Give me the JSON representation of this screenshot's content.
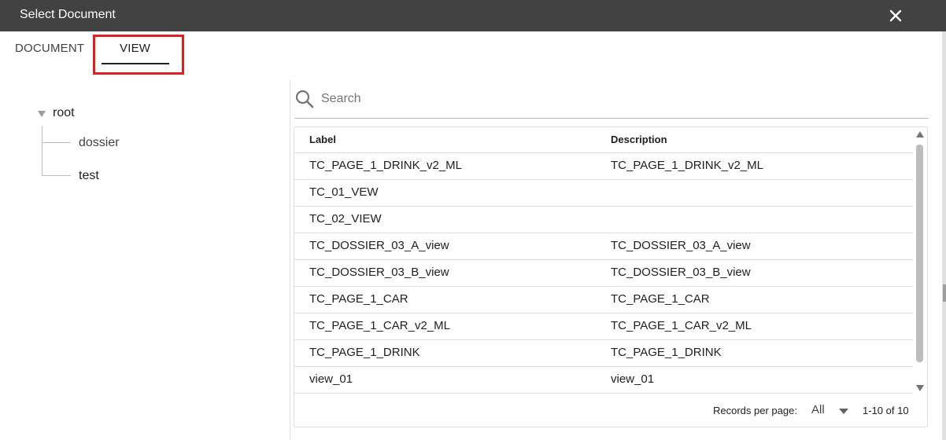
{
  "dialog": {
    "title": "Select Document",
    "close_icon": "close-icon"
  },
  "tabs": [
    {
      "label": "DOCUMENT",
      "active": false
    },
    {
      "label": "VIEW",
      "active": true
    }
  ],
  "tree": {
    "root": "root",
    "children": [
      "dossier",
      "test"
    ]
  },
  "search": {
    "placeholder": "Search",
    "value": "",
    "icon": "search-icon"
  },
  "table": {
    "columns": [
      "Label",
      "Description"
    ],
    "rows": [
      {
        "label": "TC_PAGE_1_DRINK_v2_ML",
        "description": "TC_PAGE_1_DRINK_v2_ML"
      },
      {
        "label": "TC_01_VEW",
        "description": ""
      },
      {
        "label": "TC_02_VIEW",
        "description": ""
      },
      {
        "label": "TC_DOSSIER_03_A_view",
        "description": "TC_DOSSIER_03_A_view"
      },
      {
        "label": "TC_DOSSIER_03_B_view",
        "description": "TC_DOSSIER_03_B_view"
      },
      {
        "label": "TC_PAGE_1_CAR",
        "description": "TC_PAGE_1_CAR"
      },
      {
        "label": "TC_PAGE_1_CAR_v2_ML",
        "description": "TC_PAGE_1_CAR_v2_ML"
      },
      {
        "label": "TC_PAGE_1_DRINK",
        "description": "TC_PAGE_1_DRINK"
      },
      {
        "label": "view_01",
        "description": "view_01"
      }
    ]
  },
  "pagination": {
    "records_label": "Records per page:",
    "records_value": "All",
    "range": "1-10 of 10"
  },
  "colors": {
    "titlebar": "#424242",
    "highlight": "#e02020"
  }
}
